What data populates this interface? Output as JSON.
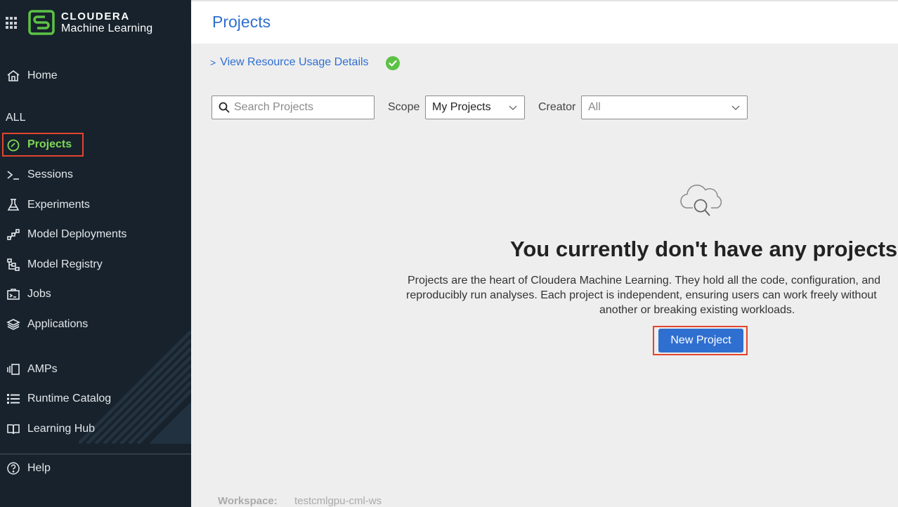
{
  "brand": {
    "line1": "CLOUDERA",
    "line2": "Machine Learning"
  },
  "sidebar": {
    "home": "Home",
    "section_all": "ALL",
    "items": [
      {
        "label": "Projects",
        "icon": "gauge-icon",
        "active": true
      },
      {
        "label": "Sessions",
        "icon": "terminal-icon"
      },
      {
        "label": "Experiments",
        "icon": "flask-icon"
      },
      {
        "label": "Model Deployments",
        "icon": "network-icon"
      },
      {
        "label": "Model Registry",
        "icon": "registry-icon"
      },
      {
        "label": "Jobs",
        "icon": "jobs-icon"
      },
      {
        "label": "Applications",
        "icon": "layers-icon"
      },
      {
        "label": "AMPs",
        "icon": "amps-icon"
      },
      {
        "label": "Runtime Catalog",
        "icon": "list-icon"
      },
      {
        "label": "Learning Hub",
        "icon": "book-icon"
      }
    ],
    "help": "Help"
  },
  "header": {
    "title": "Projects"
  },
  "resource_link": {
    "label": "View Resource Usage Details",
    "status_icon": "check-circle-icon",
    "status_color": "#5cc245"
  },
  "filters": {
    "search_placeholder": "Search Projects",
    "scope_label": "Scope",
    "scope_value": "My Projects",
    "creator_label": "Creator",
    "creator_value": "All"
  },
  "empty_state": {
    "icon": "cloud-search-icon",
    "title": "You currently don't have any projects",
    "desc_line1": "Projects are the heart of Cloudera Machine Learning. They hold all the code, configuration, and",
    "desc_line2": "reproducibly run analyses. Each project is independent, ensuring users can work freely without",
    "desc_line3": "another or breaking existing workloads.",
    "button": "New Project"
  },
  "footer": {
    "workspace_label": "Workspace:",
    "workspace_value": "testcmlgpu-cml-ws"
  },
  "colors": {
    "sidebar_bg": "#17222c",
    "accent_blue": "#2f6fd0",
    "active_green": "#7ed957",
    "highlight_red": "#e2452f"
  }
}
